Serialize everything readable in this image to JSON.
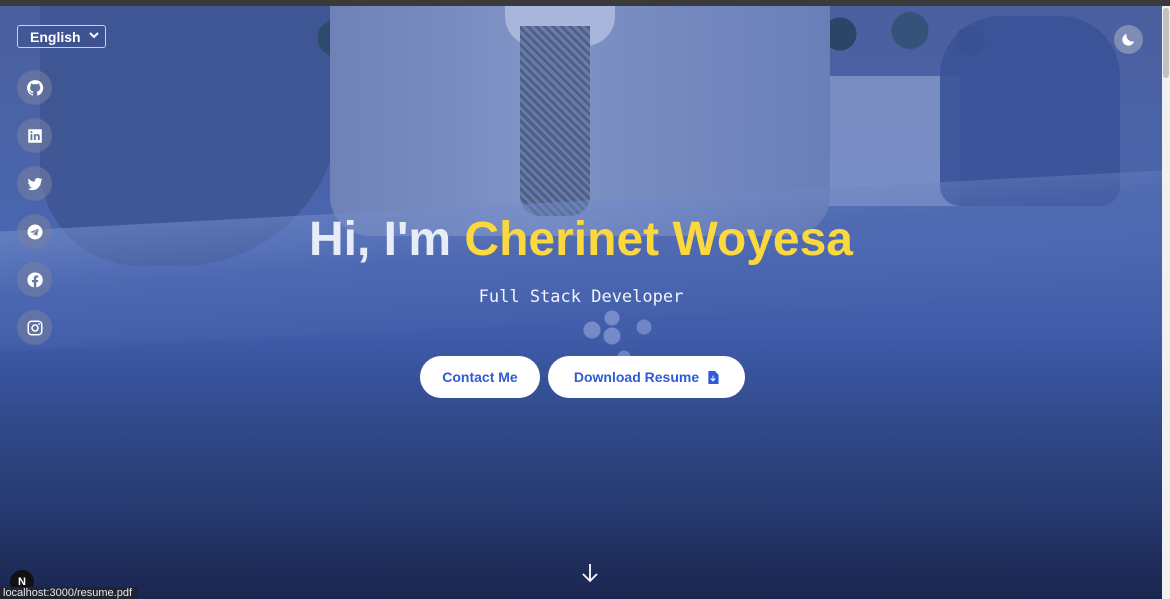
{
  "language": {
    "selected": "English"
  },
  "social": [
    {
      "name": "github-icon"
    },
    {
      "name": "linkedin-icon"
    },
    {
      "name": "twitter-icon"
    },
    {
      "name": "telegram-icon"
    },
    {
      "name": "facebook-icon"
    },
    {
      "name": "instagram-icon"
    }
  ],
  "hero": {
    "greeting": "Hi, I'm ",
    "name": "Cherinet Woyesa",
    "subtitle": "Full Stack Developer",
    "contact_label": "Contact Me",
    "resume_label": "Download Resume"
  },
  "status_url": "localhost:3000/resume.pdf",
  "dev_badge": "N",
  "colors": {
    "accent_name": "#fcd83f",
    "button_text": "#2f5bd6"
  }
}
